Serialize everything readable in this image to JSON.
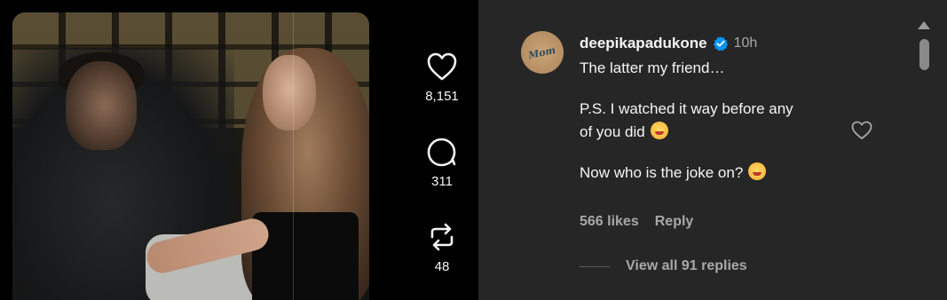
{
  "actions": {
    "likes": "8,151",
    "comments": "311",
    "reposts": "48"
  },
  "comment": {
    "avatar_text": "Mom",
    "username": "deepikapadukone",
    "time": "10h",
    "line1": "The latter my friend…",
    "line2": "P.S. I watched it way before any",
    "line3": "of you did",
    "line4": "Now who is the joke on?",
    "likes": "566 likes",
    "reply": "Reply",
    "view_replies": "View all 91 replies"
  },
  "icons": {
    "like": "heart-icon",
    "comment": "comment-bubble-icon",
    "repost": "repost-icon",
    "verified": "verified-badge-icon"
  },
  "colors": {
    "panel": "#262626",
    "text": "#f5f5f5",
    "muted": "#a8a8a8",
    "verified": "#0095f6"
  }
}
